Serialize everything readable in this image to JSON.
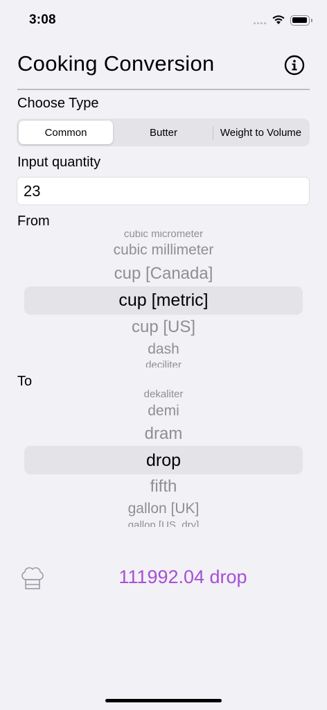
{
  "status": {
    "time": "3:08"
  },
  "app": {
    "title": "Cooking Conversion"
  },
  "type_section": {
    "label": "Choose Type",
    "segments": [
      "Common",
      "Butter",
      "Weight to Volume"
    ],
    "selected": "Common"
  },
  "quantity": {
    "label": "Input quantity",
    "value": "23"
  },
  "from_picker": {
    "label": "From",
    "items": [
      "cubic micrometer",
      "cubic millimeter",
      "cup [Canada]",
      "cup [metric]",
      "cup [US]",
      "dash",
      "deciliter"
    ],
    "selected": "cup [metric]"
  },
  "to_picker": {
    "label": "To",
    "items": [
      "dekaliter",
      "demi",
      "dram",
      "drop",
      "fifth",
      "gallon [UK]",
      "gallon [US, dry]"
    ],
    "selected": "drop"
  },
  "result": {
    "text": "111992.04 drop",
    "color": "#a64fd6"
  },
  "icons": [
    "info-icon",
    "chef-hat-icon",
    "wifi-icon",
    "battery-icon",
    "cellular-signal-icon"
  ]
}
